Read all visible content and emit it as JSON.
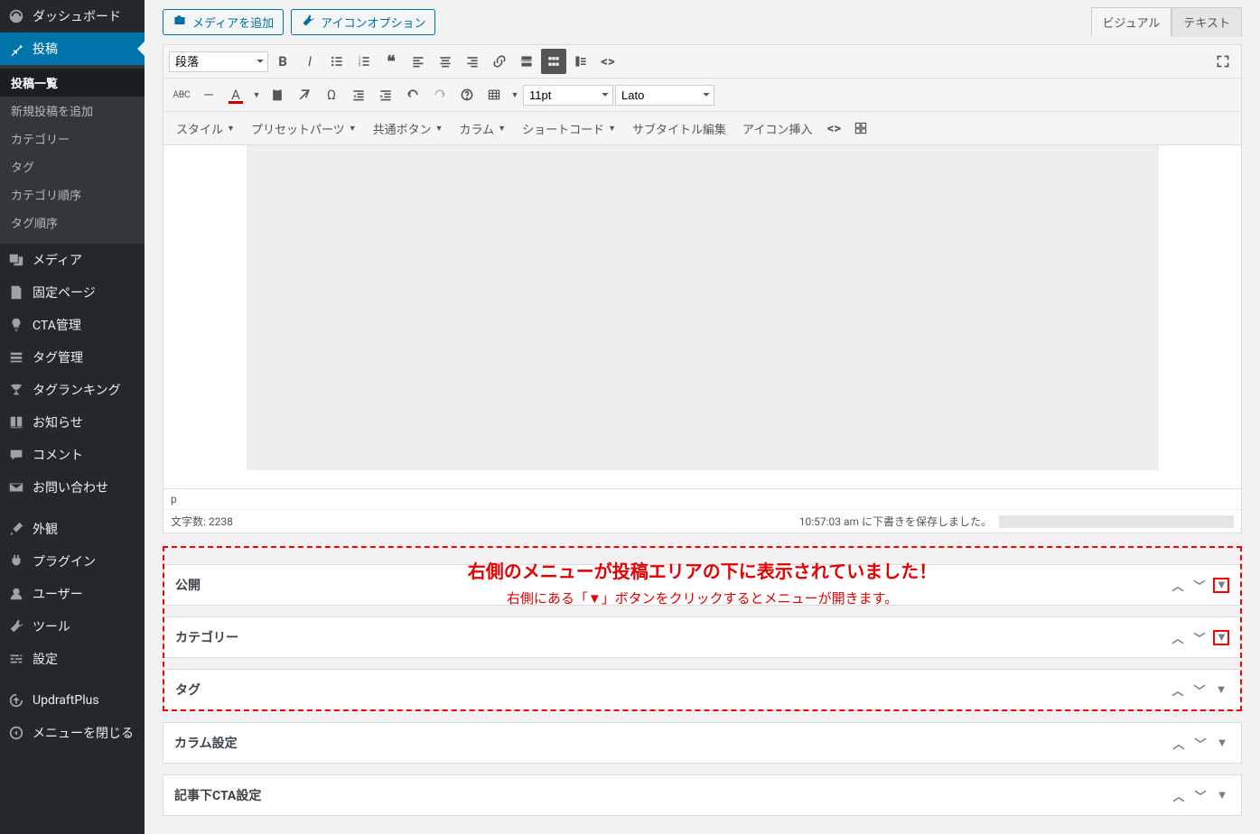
{
  "sidebar": {
    "dashboard": "ダッシュボード",
    "posts": "投稿",
    "sub": {
      "list": "投稿一覧",
      "new": "新規投稿を追加",
      "categories": "カテゴリー",
      "tags": "タグ",
      "cat_order": "カテゴリ順序",
      "tag_order": "タグ順序"
    },
    "media": "メディア",
    "pages": "固定ページ",
    "cta": "CTA管理",
    "tag_mgmt": "タグ管理",
    "tag_rank": "タグランキング",
    "notice": "お知らせ",
    "comments": "コメント",
    "contact": "お問い合わせ",
    "appearance": "外観",
    "plugins": "プラグイン",
    "users": "ユーザー",
    "tools": "ツール",
    "settings": "設定",
    "updraft": "UpdraftPlus",
    "collapse": "メニューを閉じる"
  },
  "top": {
    "add_media": "メディアを追加",
    "icon_option": "アイコンオプション",
    "tab_visual": "ビジュアル",
    "tab_text": "テキスト"
  },
  "toolbar": {
    "format_select": "段落",
    "font_size": "11pt",
    "font_family": "Lato",
    "row3": {
      "style": "スタイル",
      "preset": "プリセットパーツ",
      "common_btn": "共通ボタン",
      "column": "カラム",
      "shortcode": "ショートコード",
      "subtitle": "サブタイトル編集",
      "icon_insert": "アイコン挿入"
    }
  },
  "editor": {
    "path": "p",
    "word_count_label": "文字数: ",
    "word_count": "2238",
    "autosave": "10:57:03 am に下書きを保存しました。"
  },
  "annotation": {
    "line1": "右側のメニューが投稿エリアの下に表示されていました！",
    "line2": "右側にある「▼」ボタンをクリックするとメニューが開きます。"
  },
  "metaboxes": {
    "publish": "公開",
    "category": "カテゴリー",
    "tag": "タグ",
    "column_set": "カラム設定",
    "post_cta": "記事下CTA設定"
  }
}
